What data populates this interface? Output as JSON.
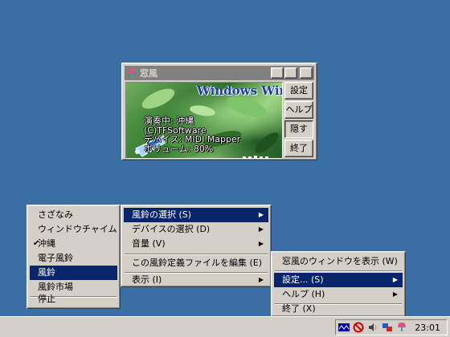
{
  "window": {
    "title": "窓風",
    "banner": "Windows Wind",
    "info": [
      "演奏中: 沖縄",
      "(C)TFSoftware",
      "デバイス: MIDI Mapper",
      "ボリューム: 80%"
    ],
    "buttons": [
      "設定",
      "ヘルプ",
      "隠す",
      "終了"
    ],
    "caption_buttons": [
      "_",
      "□",
      "×"
    ]
  },
  "menu_sounds": {
    "items": [
      {
        "label": "さざなみ",
        "checked": false,
        "selected": false
      },
      {
        "label": "ウィンドウチャイム",
        "checked": false,
        "selected": false
      },
      {
        "label": "沖縄",
        "checked": true,
        "selected": false
      },
      {
        "label": "電子風鈴",
        "checked": false,
        "selected": false
      },
      {
        "label": "風鈴",
        "checked": false,
        "selected": true
      },
      {
        "label": "風鈴市場",
        "checked": false,
        "selected": false
      }
    ],
    "stop_label": "停止"
  },
  "menu_main": {
    "items": [
      "風鈴の選択 (S)",
      "デバイスの選択 (D)",
      "音量 (V)",
      "この風鈴定義ファイルを編集 (E)",
      "表示 (I)"
    ]
  },
  "menu_tray": {
    "items": [
      "窓風のウィンドウを表示 (W)",
      "設定... (S)",
      "ヘルプ (H)",
      "終了 (X)"
    ]
  },
  "taskbar": {
    "clock": "23:01",
    "tray_icons": [
      "midi-icon",
      "no-icon",
      "volume-icon",
      "network-icon",
      "wind-bell-icon"
    ]
  },
  "colors": {
    "desktop": "#3a6ea5",
    "menu_highlight": "#0a246a",
    "face": "#d4d0c8"
  }
}
